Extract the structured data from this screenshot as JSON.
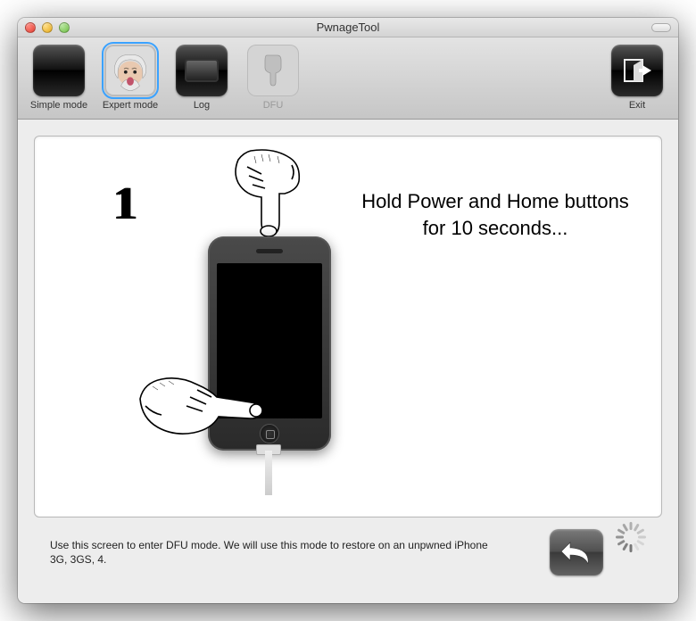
{
  "window": {
    "title": "PwnageTool"
  },
  "toolbar": {
    "simple": "Simple mode",
    "expert": "Expert mode",
    "log": "Log",
    "dfu": "DFU",
    "exit": "Exit"
  },
  "main": {
    "step_number": "1",
    "instruction": "Hold Power and Home buttons for 10 seconds..."
  },
  "footer": {
    "help_text": "Use this screen to enter DFU mode. We will use this mode to restore on an unpwned iPhone 3G, 3GS, 4."
  }
}
